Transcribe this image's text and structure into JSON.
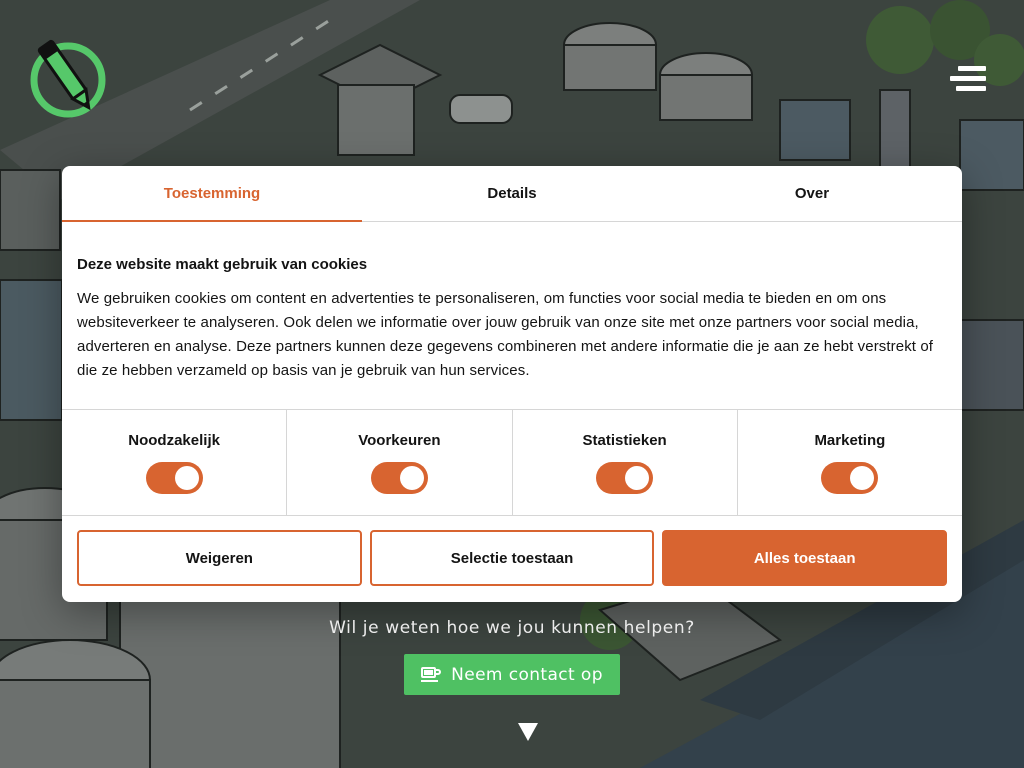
{
  "colors": {
    "accent": "#d86430",
    "contact_green": "#4fc163",
    "logo_green": "#56c86a"
  },
  "header": {
    "logo_icon": "pencil-circle-logo-icon",
    "menu_icon": "hamburger-menu-icon"
  },
  "cookie_dialog": {
    "tabs": [
      {
        "label": "Toestemming",
        "active": true
      },
      {
        "label": "Details",
        "active": false
      },
      {
        "label": "Over",
        "active": false
      }
    ],
    "heading": "Deze website maakt gebruik van cookies",
    "body": "We gebruiken cookies om content en advertenties te personaliseren, om functies voor social media te bieden en om ons websiteverkeer te analyseren. Ook delen we informatie over jouw gebruik van onze site met onze partners voor social media, adverteren en analyse. Deze partners kunnen deze gegevens combineren met andere informatie die je aan ze hebt verstrekt of die ze hebben verzameld op basis van je gebruik van hun services.",
    "toggles": [
      {
        "label": "Noodzakelijk",
        "checked": true
      },
      {
        "label": "Voorkeuren",
        "checked": true
      },
      {
        "label": "Statistieken",
        "checked": true
      },
      {
        "label": "Marketing",
        "checked": true
      }
    ],
    "buttons": {
      "deny": "Weigeren",
      "allow_selection": "Selectie toestaan",
      "allow_all": "Alles toestaan"
    }
  },
  "hero": {
    "help_text": "Wil je weten hoe we jou kunnen helpen?",
    "contact_button": "Neem contact op",
    "contact_icon": "coffee-cup-icon",
    "scroll_icon": "down-arrow-icon"
  }
}
